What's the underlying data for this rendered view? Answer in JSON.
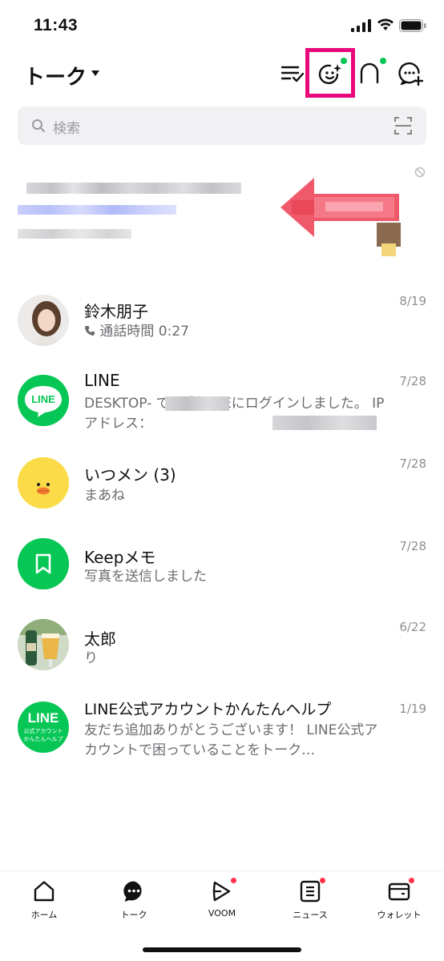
{
  "status": {
    "time": "11:43"
  },
  "header": {
    "title": "トーク"
  },
  "search": {
    "placeholder": "検索"
  },
  "chats": [
    {
      "name": "鈴木朋子",
      "message": "通話時間 0:27",
      "date": "8/19"
    },
    {
      "name": "LINE",
      "message": "DESKTOP-          でPC版LINEにログインしました。 IPアドレス：",
      "date": "7/28"
    },
    {
      "name": "いつメン (3)",
      "message": "まあね",
      "date": "7/28"
    },
    {
      "name": "Keepメモ",
      "message": "写真を送信しました",
      "date": "7/28"
    },
    {
      "name": "太郎",
      "message": "り",
      "date": "6/22"
    },
    {
      "name": "LINE公式アカウントかんたんヘルプ",
      "message": "友だち追加ありがとうございます！ LINE公式アカウントで困っていることをトーク…",
      "date": "1/19"
    }
  ],
  "avatars": {
    "line_logo": "LINE",
    "help_logo_main": "LINE",
    "help_logo_sub1": "公式アカウント",
    "help_logo_sub2": "かんたんヘルプ"
  },
  "tabs": [
    {
      "label": "ホーム",
      "icon": "home-icon"
    },
    {
      "label": "トーク",
      "icon": "chat-icon"
    },
    {
      "label": "VOOM",
      "icon": "voom-icon"
    },
    {
      "label": "ニュース",
      "icon": "news-icon"
    },
    {
      "label": "ウォレット",
      "icon": "wallet-icon"
    }
  ],
  "colors": {
    "line_green": "#06c755",
    "highlight": "#e8087c",
    "notification_red": "#ff334b",
    "sally_yellow": "#fbdc48"
  }
}
